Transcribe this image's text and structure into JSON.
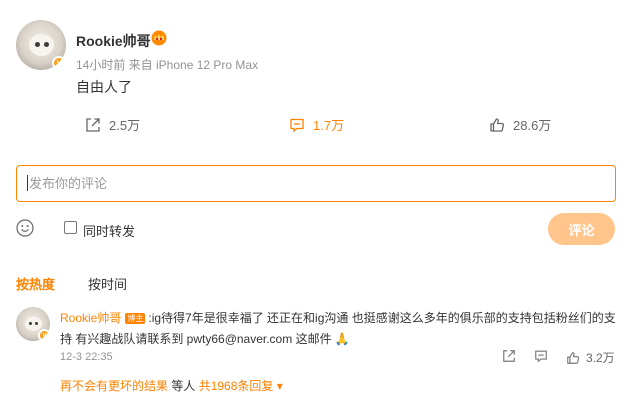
{
  "post": {
    "username": "Rookie帅哥",
    "meta": "14小时前  来自 iPhone 12 Pro Max",
    "text": "自由人了",
    "actions": {
      "repost_count": "2.5万",
      "comment_count": "1.7万",
      "like_count": "28.6万"
    }
  },
  "composer": {
    "placeholder": "发布你的评论",
    "forward_label": "同时转发",
    "submit_label": "评论"
  },
  "sort": {
    "hot_label": "按热度",
    "time_label": "按时间"
  },
  "comment": {
    "username": "Rookie帅哥",
    "tag": "博主",
    "text_line1": ":ig待得7年是很幸福了 还正在和ig沟通 也挺感谢这么多年的俱乐部的支持包括粉丝们的支",
    "text_line2": "持 有兴趣战队请联系到 pwty66@naver.com 这邮件 🙏",
    "time": "12-3 22:35",
    "like_count": "3.2万"
  },
  "replies": {
    "prefix": "再不会有更坏的结果",
    "middle": " 等人 ",
    "suffix": "共1968条回复 ▾"
  },
  "colors": {
    "accent": "#ff8200",
    "submit_disabled": "#ffc58a",
    "muted_text": "#939393"
  },
  "icons": [
    "repost-icon",
    "comment-icon",
    "like-icon",
    "emoji-icon",
    "crown-icon",
    "verified-icon"
  ]
}
